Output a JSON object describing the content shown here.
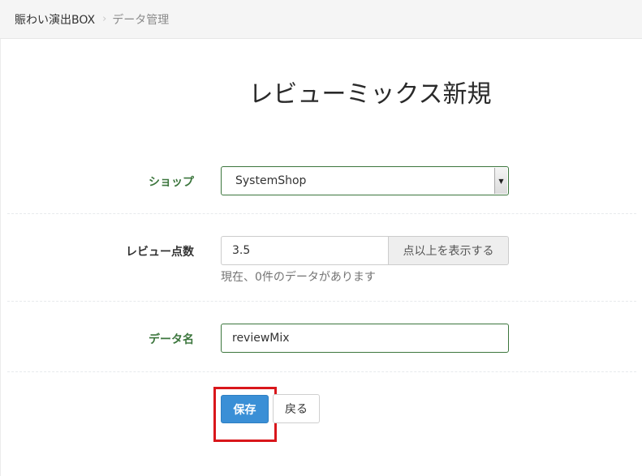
{
  "breadcrumb": {
    "home": "賑わい演出BOX",
    "separator": "›",
    "current": "データ管理"
  },
  "page": {
    "title": "レビューミックス新規"
  },
  "form": {
    "shop": {
      "label": "ショップ",
      "value": "SystemShop"
    },
    "review_score": {
      "label": "レビュー点数",
      "value": "3.5",
      "addon": "点以上を表示する",
      "help": "現在、0件のデータがあります"
    },
    "data_name": {
      "label": "データ名",
      "value": "reviewMix"
    }
  },
  "actions": {
    "save_label": "保存",
    "back_label": "戻る"
  },
  "colors": {
    "primary": "#3a8fd6",
    "label_success": "#3c763d",
    "highlight": "#d9161b"
  }
}
